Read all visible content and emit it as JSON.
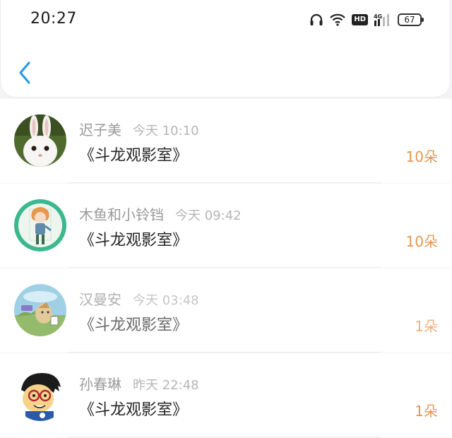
{
  "status_bar": {
    "time": "20:27",
    "hd_label": "HD",
    "network": "4G",
    "battery": "67"
  },
  "colors": {
    "accent_blue": "#2b9be8",
    "amount_orange": "#e8964f",
    "amount_light": "#f2b07a"
  },
  "items": [
    {
      "name": "迟子美",
      "time": "今天 10:10",
      "title": "《斗龙观影室》",
      "amount": "10朵"
    },
    {
      "name": "木鱼和小铃铛",
      "time": "今天 09:42",
      "title": "《斗龙观影室》",
      "amount": "10朵"
    },
    {
      "name": "汉曼安",
      "time": "今天 03:48",
      "title": "《斗龙观影室》",
      "amount": "1朵"
    },
    {
      "name": "孙春琳",
      "time": "昨天 22:48",
      "title": "《斗龙观影室》",
      "amount": "1朵"
    }
  ]
}
